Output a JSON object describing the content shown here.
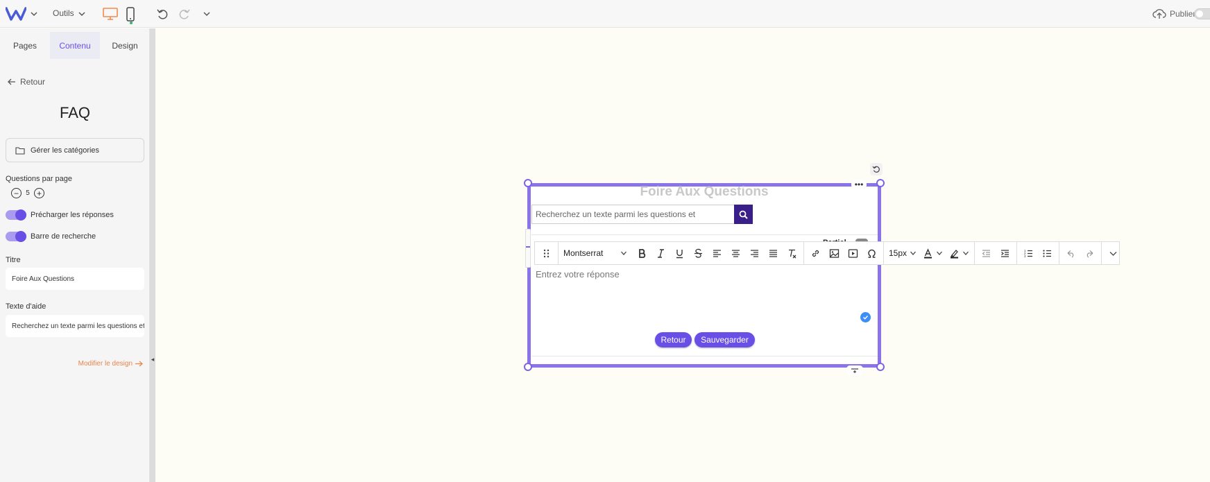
{
  "topbar": {
    "tools_label": "Outils",
    "publish_label": "Publier"
  },
  "panel": {
    "tabs": [
      {
        "label": "Pages"
      },
      {
        "label": "Contenu"
      },
      {
        "label": "Design"
      }
    ],
    "back_label": "Retour",
    "title": "FAQ",
    "manage_categories_label": "Gérer les catégories",
    "questions_per_page_label": "Questions par page",
    "questions_per_page_value": "5",
    "preload_answers_label": "Précharger les réponses",
    "search_bar_label": "Barre de recherche",
    "title_label": "Titre",
    "title_value": "Foire Aux Questions",
    "help_text_label": "Texte d'aide",
    "help_text_value": "Recherchez un texte parmi les questions et",
    "modify_design_label": "Modifier le design"
  },
  "widget": {
    "title": "Foire Aux Questions",
    "search_placeholder": "Recherchez un texte parmi les questions et",
    "partial_label": "Partiel",
    "answer_placeholder": "Entrez votre réponse",
    "back_button": "Retour",
    "save_button": "Sauvegarder"
  },
  "toolbar": {
    "font": "Montserrat",
    "font_size": "15px"
  },
  "colors": {
    "accent": "#6a4fe6",
    "selection": "#8b74ea",
    "search_button": "#3a1f8a",
    "link_orange": "#e8854a"
  }
}
